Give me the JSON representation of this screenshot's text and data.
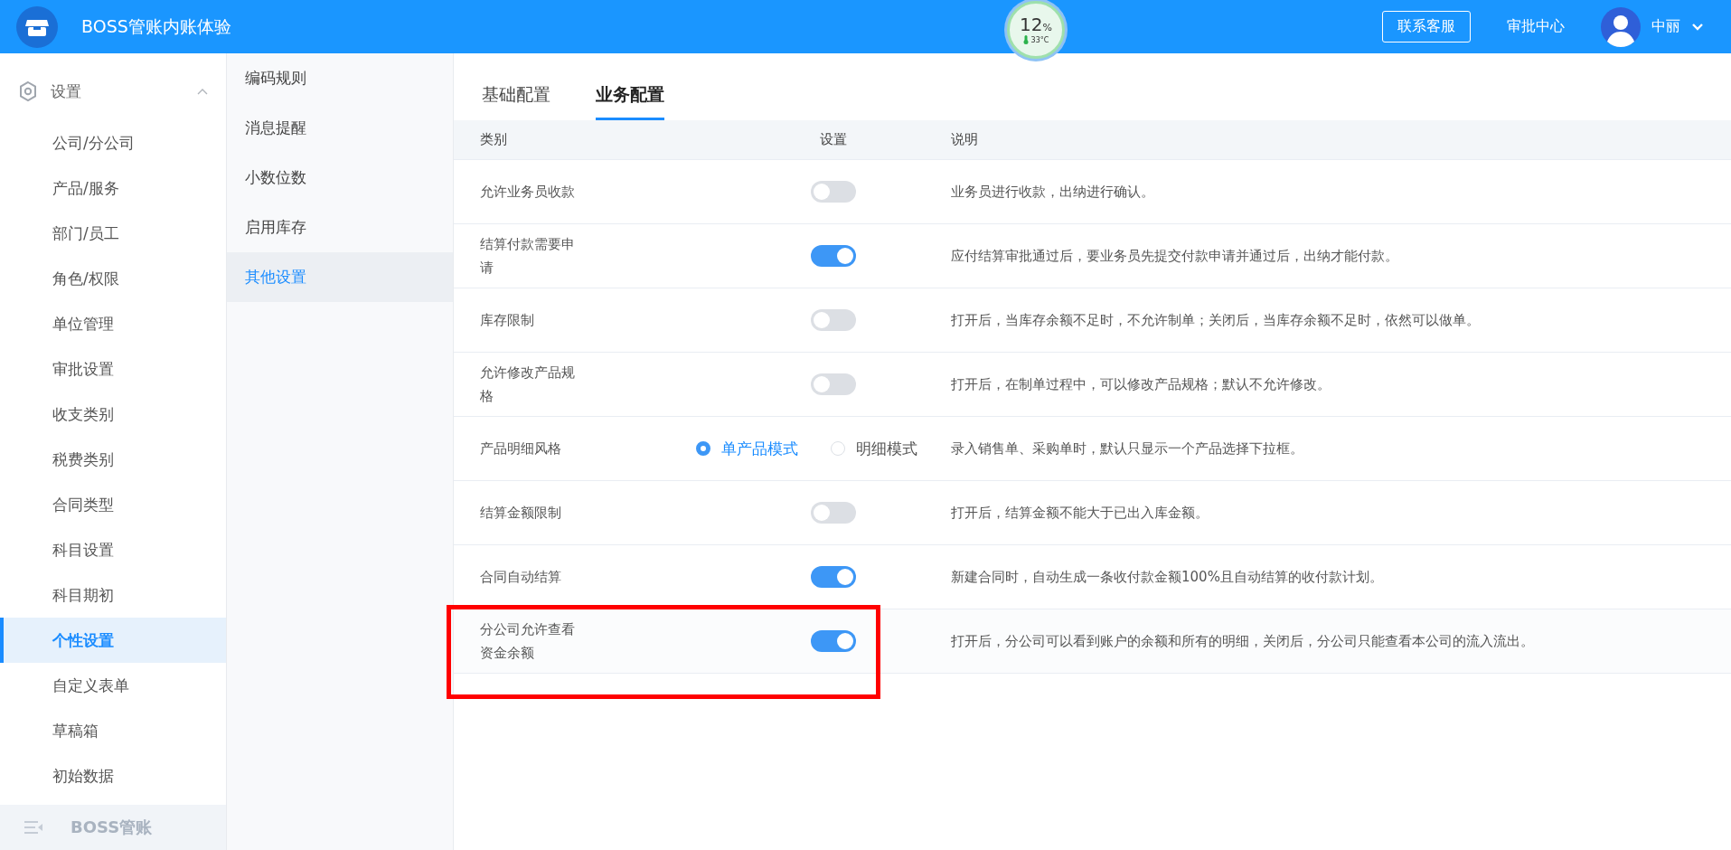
{
  "header": {
    "app_title": "BOSS管账内账体验",
    "gauge": {
      "percent": "12",
      "unit": "%",
      "temperature": "33°C"
    },
    "buttons": [
      {
        "label": "联系客服",
        "kind": "outlined"
      },
      {
        "label": "审批中心",
        "kind": "plain"
      }
    ],
    "user": {
      "name": "中丽"
    }
  },
  "sidebar": {
    "group": {
      "label": "设置",
      "expanded": true
    },
    "items": [
      {
        "label": "公司/分公司",
        "selected": false
      },
      {
        "label": "产品/服务",
        "selected": false
      },
      {
        "label": "部门/员工",
        "selected": false
      },
      {
        "label": "角色/权限",
        "selected": false
      },
      {
        "label": "单位管理",
        "selected": false
      },
      {
        "label": "审批设置",
        "selected": false
      },
      {
        "label": "收支类别",
        "selected": false
      },
      {
        "label": "税费类别",
        "selected": false
      },
      {
        "label": "合同类型",
        "selected": false
      },
      {
        "label": "科目设置",
        "selected": false
      },
      {
        "label": "科目期初",
        "selected": false
      },
      {
        "label": "个性设置",
        "selected": true
      },
      {
        "label": "自定义表单",
        "selected": false
      },
      {
        "label": "草稿箱",
        "selected": false
      },
      {
        "label": "初始数据",
        "selected": false
      }
    ],
    "footer": "BOSS管账"
  },
  "subnav": [
    {
      "label": "编码规则",
      "selected": false
    },
    {
      "label": "消息提醒",
      "selected": false
    },
    {
      "label": "小数位数",
      "selected": false
    },
    {
      "label": "启用库存",
      "selected": false
    },
    {
      "label": "其他设置",
      "selected": true
    }
  ],
  "tabs": [
    {
      "label": "基础配置",
      "selected": false
    },
    {
      "label": "业务配置",
      "selected": true
    }
  ],
  "table": {
    "columns": [
      "类别",
      "设置",
      "说明"
    ],
    "rows": [
      {
        "category": "允许业务员收款",
        "kind": "toggle",
        "on": false,
        "description": "业务员进行收款，出纳进行确认。",
        "highlighted": false
      },
      {
        "category": "结算付款需要申请",
        "kind": "toggle",
        "on": true,
        "description": "应付结算审批通过后，要业务员先提交付款申请并通过后，出纳才能付款。",
        "highlighted": false
      },
      {
        "category": "库存限制",
        "kind": "toggle",
        "on": false,
        "description": "打开后，当库存余额不足时，不允许制单；关闭后，当库存余额不足时，依然可以做单。",
        "highlighted": false
      },
      {
        "category": "允许修改产品规格",
        "kind": "toggle",
        "on": false,
        "description": "打开后，在制单过程中，可以修改产品规格；默认不允许修改。",
        "highlighted": false
      },
      {
        "category": "产品明细风格",
        "kind": "radio",
        "options": [
          {
            "label": "单产品模式",
            "selected": true
          },
          {
            "label": "明细模式",
            "selected": false
          }
        ],
        "description": "录入销售单、采购单时，默认只显示一个产品选择下拉框。",
        "highlighted": false
      },
      {
        "category": "结算金额限制",
        "kind": "toggle",
        "on": false,
        "description": "打开后，结算金额不能大于已出入库金额。",
        "highlighted": false
      },
      {
        "category": "合同自动结算",
        "kind": "toggle",
        "on": true,
        "description": "新建合同时，自动生成一条收付款金额100%且自动结算的收付款计划。",
        "highlighted": false
      },
      {
        "category": "分公司允许查看资金余额",
        "kind": "toggle",
        "on": true,
        "description": "打开后，分公司可以看到账户的余额和所有的明细，关闭后，分公司只能查看本公司的流入流出。",
        "highlighted": true
      }
    ]
  }
}
